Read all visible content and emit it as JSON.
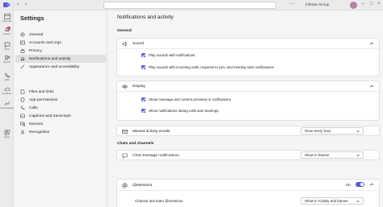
{
  "topbar": {
    "org_name": "Infinitus Group"
  },
  "rail": {
    "items": [
      {
        "label": "Calendar",
        "icon": "calendar-icon"
      },
      {
        "label": "Activity",
        "icon": "bell-icon",
        "badge": "1"
      },
      {
        "label": "Chat",
        "icon": "chat-icon"
      },
      {
        "label": "Teams",
        "icon": "teams-icon"
      },
      {
        "label": "Calls",
        "icon": "phone-icon"
      },
      {
        "label": "OneDrive",
        "icon": "onedrive-icon"
      },
      {
        "label": "Viva Insights",
        "icon": "insights-icon"
      },
      {
        "label": "Apps",
        "icon": "apps-icon"
      }
    ]
  },
  "settings_nav": {
    "title": "Settings",
    "items": [
      {
        "label": "General",
        "icon": "gear-icon"
      },
      {
        "label": "Accounts and orgs",
        "icon": "accounts-icon"
      },
      {
        "label": "Privacy",
        "icon": "lock-icon"
      },
      {
        "label": "Notifications and activity",
        "icon": "bell-icon",
        "active": true
      },
      {
        "label": "Appearance and accessibility",
        "icon": "brush-icon"
      },
      {
        "label": "Files and links",
        "icon": "file-icon"
      },
      {
        "label": "App permissions",
        "icon": "shield-icon"
      },
      {
        "label": "Calls",
        "icon": "phone-icon"
      },
      {
        "label": "Captions and transcripts",
        "icon": "captions-icon"
      },
      {
        "label": "Devices",
        "icon": "devices-icon"
      },
      {
        "label": "Recognition",
        "icon": "recognition-icon"
      }
    ]
  },
  "main": {
    "title": "Notifications and activity",
    "general_label": "General",
    "sound": {
      "label": "Sound",
      "options": [
        "Play sounds with notifications",
        "Play sounds with incoming calls, requests to join, and meeting start notifications"
      ]
    },
    "display": {
      "label": "Display",
      "options": [
        "Show message and content previews in notifications",
        "Show notifications during calls and meetings"
      ]
    },
    "missed_activity": {
      "label": "Missed activity emails",
      "value": "Once every hour"
    },
    "chats_label": "Chats and channels",
    "chat_messages": {
      "label": "Chat message notifications",
      "value": "Show in banner"
    },
    "mentions": {
      "label": "@Mentions",
      "toggle_label": "On",
      "channel_label": "Channel and team @mentions",
      "channel_value": "Show in Activity and banner"
    }
  },
  "colors": {
    "accent": "#5b5fc7",
    "badge": "#c4314b"
  }
}
